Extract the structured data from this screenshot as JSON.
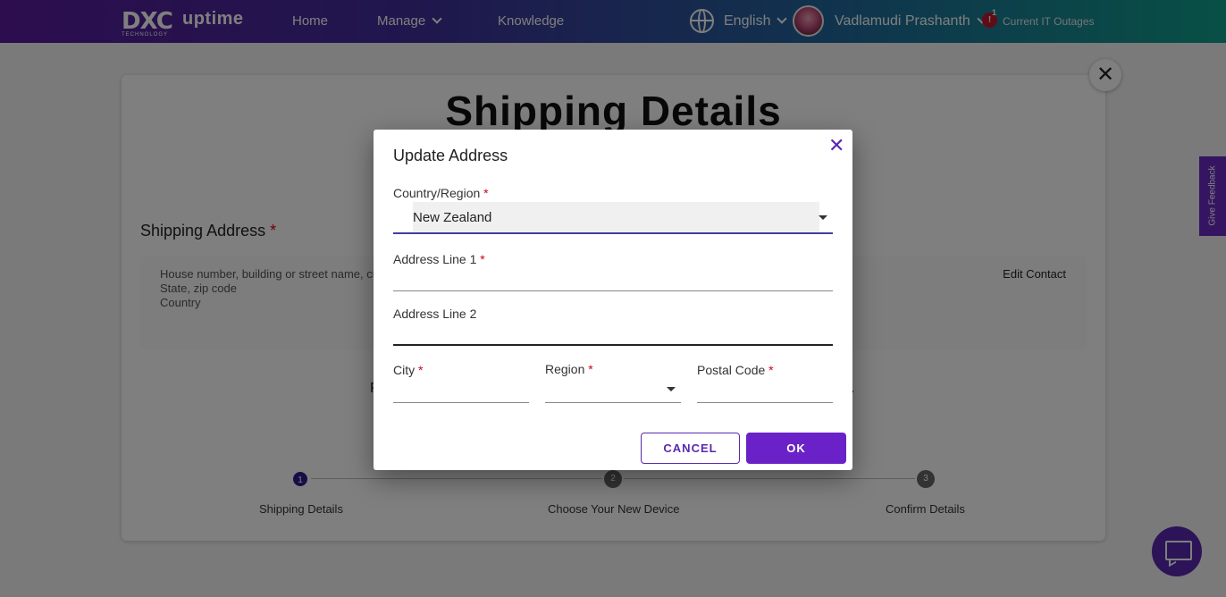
{
  "topbar": {
    "logo_text": "DXC",
    "logo_sub": "TECHNOLOGY",
    "brand": "uptime",
    "nav": {
      "home": "Home",
      "manage": "Manage",
      "knowledge": "Knowledge"
    },
    "language": "English",
    "user_name": "Vadlamudi Prashanth",
    "alert_count": "1",
    "alert_symbol": "!",
    "outages_label": "Current IT Outages",
    "gradient_colors": [
      "#5a1a9c",
      "#10a08c"
    ]
  },
  "page": {
    "title": "Shipping Details",
    "shipping_address_label": "Shipping Address",
    "required_mark": "*",
    "address_placeholder_lines": [
      "House number, building or street name, city",
      "State, zip code",
      "Country"
    ],
    "edit_contact": "Edit Contact",
    "bg_fragment_left": "P",
    "bg_fragment_right": ".",
    "steps": [
      {
        "number": "1",
        "label": "Shipping Details"
      },
      {
        "number": "2",
        "label": "Choose Your New Device"
      },
      {
        "number": "3",
        "label": "Confirm Details"
      }
    ],
    "close_symbol": "✕"
  },
  "feedback": {
    "label": "Give Feedback"
  },
  "dialog": {
    "title": "Update Address",
    "close_symbol": "✕",
    "country_label": "Country/Region",
    "country_value": "New Zealand",
    "address1_label": "Address Line 1",
    "address1_value": "",
    "address2_label": "Address Line 2",
    "address2_value": "",
    "city_label": "City",
    "city_value": "",
    "region_label": "Region",
    "region_value": "",
    "postal_label": "Postal Code",
    "postal_value": "",
    "required_mark": "*",
    "cancel_label": "CANCEL",
    "ok_label": "OK",
    "accent_color": "#6a22c8"
  }
}
